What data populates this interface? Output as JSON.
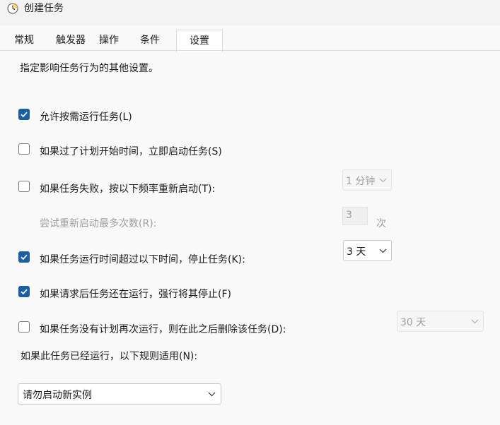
{
  "window": {
    "title": "创建任务",
    "icon": "task-scheduler-clock-icon"
  },
  "tabs": [
    {
      "label": "常规",
      "active": false
    },
    {
      "label": "触发器",
      "active": false
    },
    {
      "label": "操作",
      "active": false
    },
    {
      "label": "条件",
      "active": false
    },
    {
      "label": "设置",
      "active": true
    }
  ],
  "settings": {
    "description": "指定影响任务行为的其他设置。",
    "allow_on_demand": {
      "label": "允许按需运行任务(L)",
      "checked": true
    },
    "run_missed": {
      "label": "如果过了计划开始时间，立即启动任务(S)",
      "checked": false
    },
    "restart_on_failure": {
      "label": "如果任务失败，按以下频率重新启动(T):",
      "checked": false,
      "interval": "1 分钟"
    },
    "restart_attempts": {
      "label": "尝试重新启动最多次数(R):",
      "value": "3",
      "unit": "次"
    },
    "stop_if_runs_longer": {
      "label": "如果任务运行时间超过以下时间，停止任务(K):",
      "checked": true,
      "duration": "3 天"
    },
    "force_stop": {
      "label": "如果请求后任务还在运行，强行将其停止(F)",
      "checked": true
    },
    "delete_if_not_scheduled": {
      "label": "如果任务没有计划再次运行，则在此之后删除该任务(D):",
      "checked": false,
      "delay": "30 天"
    },
    "rule": {
      "label": "如果此任务已经运行，以下规则适用(N):",
      "selected": "请勿启动新实例"
    }
  },
  "colors": {
    "accent": "#1c5ea6",
    "background": "#f9f9f9",
    "disabled_text": "#9e9e9e"
  }
}
